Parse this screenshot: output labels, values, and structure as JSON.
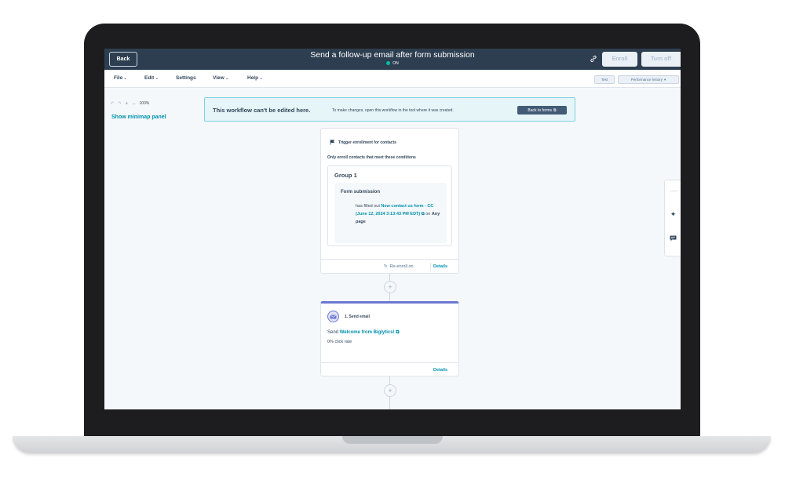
{
  "header": {
    "back_label": "Back",
    "workflow_title": "Send a follow-up email after form submission",
    "status": "ON",
    "enroll_label": "Enroll",
    "turn_off_label": "Turn off",
    "status_color": "#00bda5"
  },
  "menu": {
    "items": [
      "File",
      "Edit",
      "Settings",
      "View",
      "Help"
    ],
    "test_label": "Test",
    "performance_label": "Performance history"
  },
  "canvas": {
    "zoom": "100%",
    "minimap_label": "Show minimap panel"
  },
  "banner": {
    "title": "This workflow can't be edited here.",
    "text": "To make changes, open this workflow in the tool where it was created.",
    "button": "Back to forms"
  },
  "trigger": {
    "title": "Trigger enrollment for contacts",
    "subtitle": "Only enroll contacts that meet these conditions",
    "group_title": "Group 1",
    "condition_title": "Form submission",
    "condition_prefix": "has filled out",
    "form_name": "New contact us form - CC (June 12, 2024 3:13:43 PM EDT)",
    "condition_mid": "on",
    "page": "Any page",
    "reenroll_label": "Re-enroll on",
    "details_label": "Details"
  },
  "action": {
    "label": "1. Send email",
    "send_prefix": "Send",
    "email_name": "Welcome from Biglytics!",
    "click_rate": "0% click rate",
    "details_label": "Details",
    "accent_color": "#6a78d1"
  }
}
